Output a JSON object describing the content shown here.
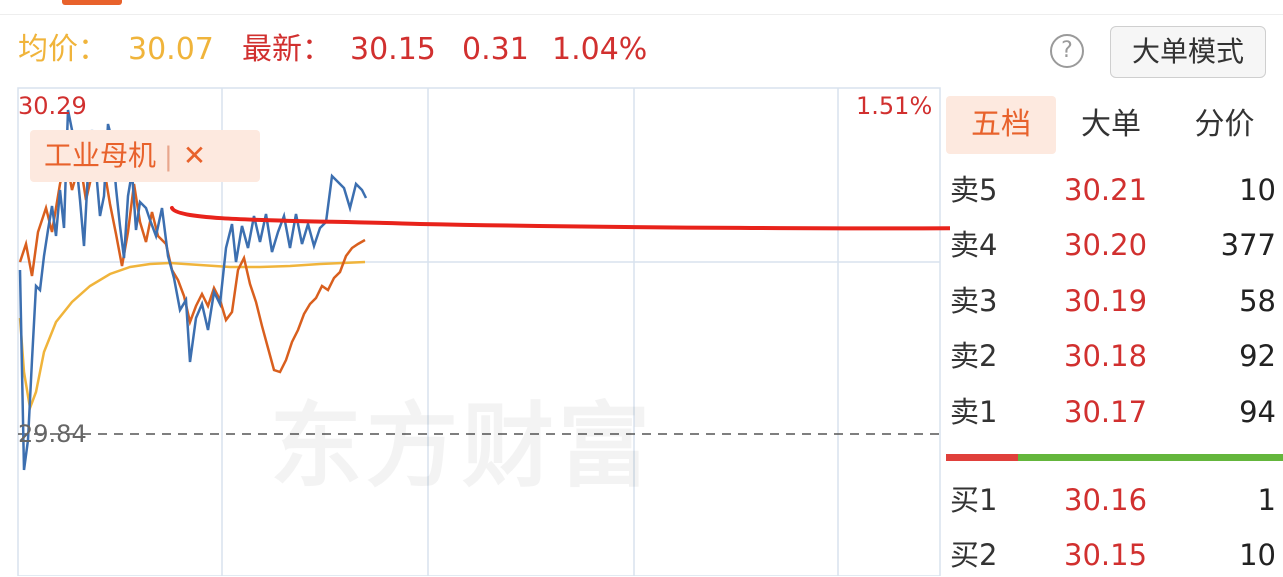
{
  "header": {
    "avg_label": "均价：",
    "avg_value": "30.07",
    "latest_label": "最新：",
    "latest_value": "30.15",
    "change": "0.31",
    "change_pct": "1.04%",
    "help_icon": "question-circle-icon",
    "mode_button": "大单模式"
  },
  "chart": {
    "price_high": "30.29",
    "pct_high": "1.51%",
    "price_base": "29.84",
    "sector_tag": "工业母机",
    "sector_sep": "|",
    "sector_close": "✕",
    "watermark": "东方财富",
    "colors": {
      "price_line": "#3c6fb0",
      "avg_line": "#f0b43b",
      "sector_line": "#d95f1e",
      "annotation": "#e8231b"
    }
  },
  "orderbook": {
    "tabs": [
      "五档",
      "大单",
      "分价"
    ],
    "asks": [
      {
        "label": "卖5",
        "price": "30.21",
        "qty": "10"
      },
      {
        "label": "卖4",
        "price": "30.20",
        "qty": "377"
      },
      {
        "label": "卖3",
        "price": "30.19",
        "qty": "58"
      },
      {
        "label": "卖2",
        "price": "30.18",
        "qty": "92"
      },
      {
        "label": "卖1",
        "price": "30.17",
        "qty": "94"
      }
    ],
    "bids": [
      {
        "label": "买1",
        "price": "30.16",
        "qty": "1"
      },
      {
        "label": "买2",
        "price": "30.15",
        "qty": "10"
      }
    ]
  }
}
